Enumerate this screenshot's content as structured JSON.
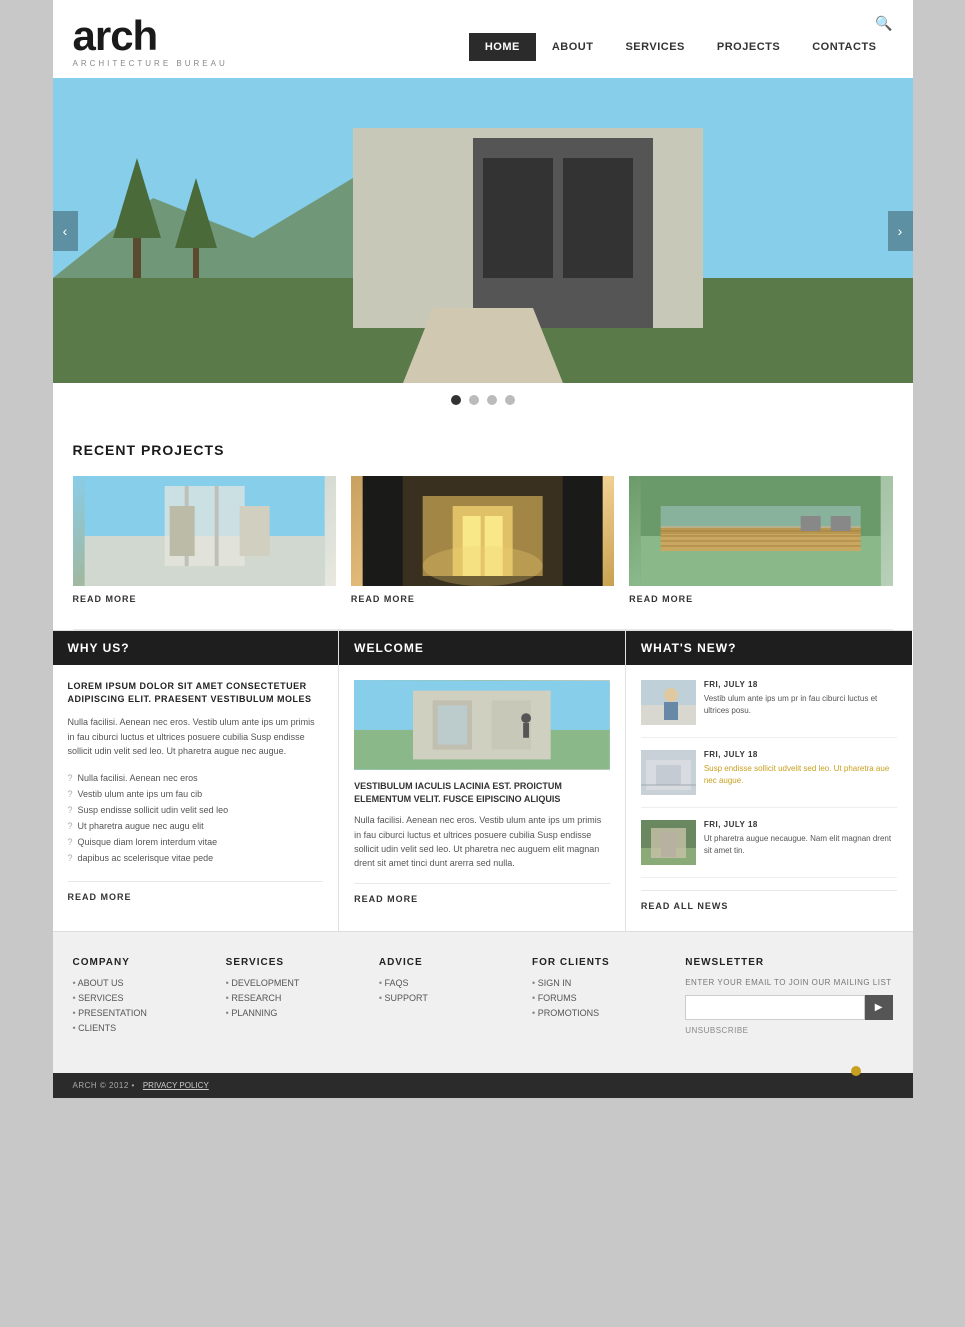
{
  "site": {
    "logo_text": "arch",
    "logo_sub": "ARCHITECTURE BUREAU",
    "nav": [
      {
        "label": "HOME",
        "active": true
      },
      {
        "label": "ABOUT",
        "active": false
      },
      {
        "label": "SERVICES",
        "active": false
      },
      {
        "label": "PROJECTS",
        "active": false
      },
      {
        "label": "CONTACTS",
        "active": false
      }
    ]
  },
  "slider": {
    "dots": [
      true,
      false,
      false,
      false
    ]
  },
  "recent_projects": {
    "title": "RECENT PROJECTS",
    "cards": [
      {
        "read_more": "READ MORE"
      },
      {
        "read_more": "READ MORE"
      },
      {
        "read_more": "READ MORE"
      }
    ]
  },
  "why_us": {
    "title": "WHY US?",
    "headline": "LOREM IPSUM DOLOR SIT AMET CONSECTETUER ADIPISCING ELIT. PRAESENT VESTIBULUM MOLES",
    "body": "Nulla facilisi. Aenean nec eros. Vestib ulum ante ips um primis in fau ciburci luctus et ultrices posuere cubilia Susp endisse sollicit udin velit sed leo. Ut pharetra augue nec augue.",
    "bullets": [
      "Nulla facilisi. Aenean nec eros",
      "Vestib ulum ante ips um fau cib",
      "Susp endisse sollicit udin velit sed leo",
      "Ut pharetra augue nec augu elit",
      "Quisque diam lorem interdum vitae",
      "dapibus ac scelerisque vitae pede"
    ],
    "read_more": "READ MORE"
  },
  "welcome": {
    "title": "WELCOME",
    "caption": "VESTIBULUM IACULIS LACINIA EST. PROICTUM ELEMENTUM VELIT. FUSCE EIPISCINO ALIQUIS",
    "body": "Nulla facilisi. Aenean nec eros. Vestib ulum ante ips um primis in fau ciburci luctus et ultrices posuere cubilia Susp endisse sollicit udin velit sed leo. Ut pharetra nec auguem elit magnan drent sit amet tinci dunt arerra sed nulla.",
    "read_more": "READ MORE"
  },
  "whats_new": {
    "title": "WHAT'S NEW?",
    "news": [
      {
        "date": "FRI, JULY 18",
        "text": "Vestib ulum ante ips um pr in fau ciburci luctus et ultrices posu.",
        "highlight": false
      },
      {
        "date": "FRI, JULY 18",
        "text": "Susp endisse sollicit udvelit sed leo. Ut pharetra aue nec augue.",
        "highlight": true
      },
      {
        "date": "FRI, JULY 18",
        "text": "Ut pharetra augue necaugue. Nam elit magnan drent sit amet tin.",
        "highlight": false
      }
    ],
    "read_all": "READ ALL NEWS"
  },
  "footer": {
    "company": {
      "title": "COMPANY",
      "links": [
        "ABOUT US",
        "SERVICES",
        "PRESENTATION",
        "CLIENTS"
      ]
    },
    "services": {
      "title": "SERVICES",
      "links": [
        "DEVELOPMENT",
        "RESEARCH",
        "PLANNING"
      ]
    },
    "advice": {
      "title": "ADVICE",
      "links": [
        "FAQS",
        "SUPPORT"
      ]
    },
    "for_clients": {
      "title": "FOR CLIENTS",
      "links": [
        "SIGN IN",
        "FORUMS",
        "PROMOTIONS"
      ]
    },
    "newsletter": {
      "title": "NEWSLETTER",
      "desc": "ENTER YOUR EMAIL TO JOIN OUR MAILING LIST",
      "placeholder": "",
      "btn_label": "▶",
      "unsubscribe": "UNSUBSCRIBE"
    },
    "bottom": {
      "copy": "ARCH © 2012 •",
      "privacy": "PRIVACY POLICY"
    }
  }
}
